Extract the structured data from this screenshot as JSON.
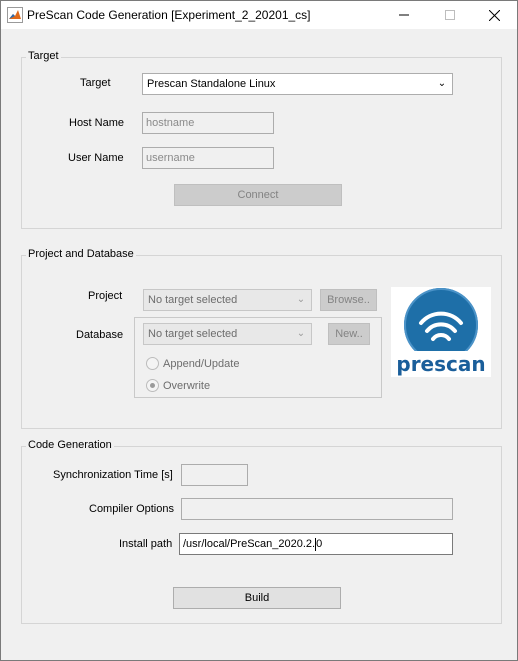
{
  "window": {
    "title": "PreScan Code Generation [Experiment_2_20201_cs]",
    "icons": {
      "app": "matlab-logo-icon",
      "minimize": "minimize-icon",
      "maximize": "maximize-icon",
      "close": "close-icon"
    }
  },
  "target_group": {
    "title": "Target",
    "target_label": "Target",
    "target_value": "Prescan Standalone Linux",
    "host_label": "Host Name",
    "host_placeholder": "hostname",
    "user_label": "User Name",
    "user_placeholder": "username",
    "connect_label": "Connect"
  },
  "project_group": {
    "title": "Project and Database",
    "project_label": "Project",
    "project_value": "No target selected",
    "browse_label": "Browse..",
    "database_label": "Database",
    "database_value": "No target selected",
    "new_label": "New..",
    "append_label": "Append/Update",
    "overwrite_label": "Overwrite",
    "overwrite_selected": true,
    "logo_text": "prescan"
  },
  "codegen_group": {
    "title": "Code Generation",
    "sync_label": "Synchronization Time [s]",
    "sync_value": "",
    "compiler_label": "Compiler Options",
    "compiler_value": "",
    "install_label": "Install path",
    "install_value_before_caret": "/usr/local/PreScan_2020.2.",
    "install_value_after_caret": "0",
    "build_label": "Build"
  },
  "colors": {
    "logo_blue": "#1e6fa8",
    "logo_text_blue": "#1a5e9a"
  }
}
